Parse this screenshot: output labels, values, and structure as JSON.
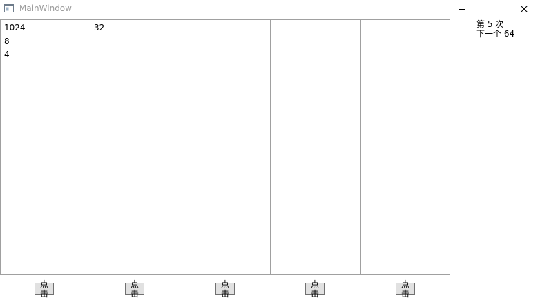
{
  "window": {
    "title": "MainWindow"
  },
  "panels": [
    {
      "lines": [
        "1024",
        "8",
        "4"
      ]
    },
    {
      "lines": [
        "32"
      ]
    },
    {
      "lines": []
    },
    {
      "lines": []
    },
    {
      "lines": []
    }
  ],
  "buttons": {
    "click_label": "点击"
  },
  "status": {
    "round_text": "第 5 次",
    "next_text": "下一个 64"
  },
  "icons": {
    "app": "window-app-icon",
    "minimize": "minimize-icon",
    "maximize": "maximize-icon",
    "close": "close-icon"
  },
  "colors": {
    "panel_border": "#a0a0a0",
    "button_bg": "#e1e1e1",
    "button_border": "#707070",
    "title_text": "#9a9a9a"
  }
}
